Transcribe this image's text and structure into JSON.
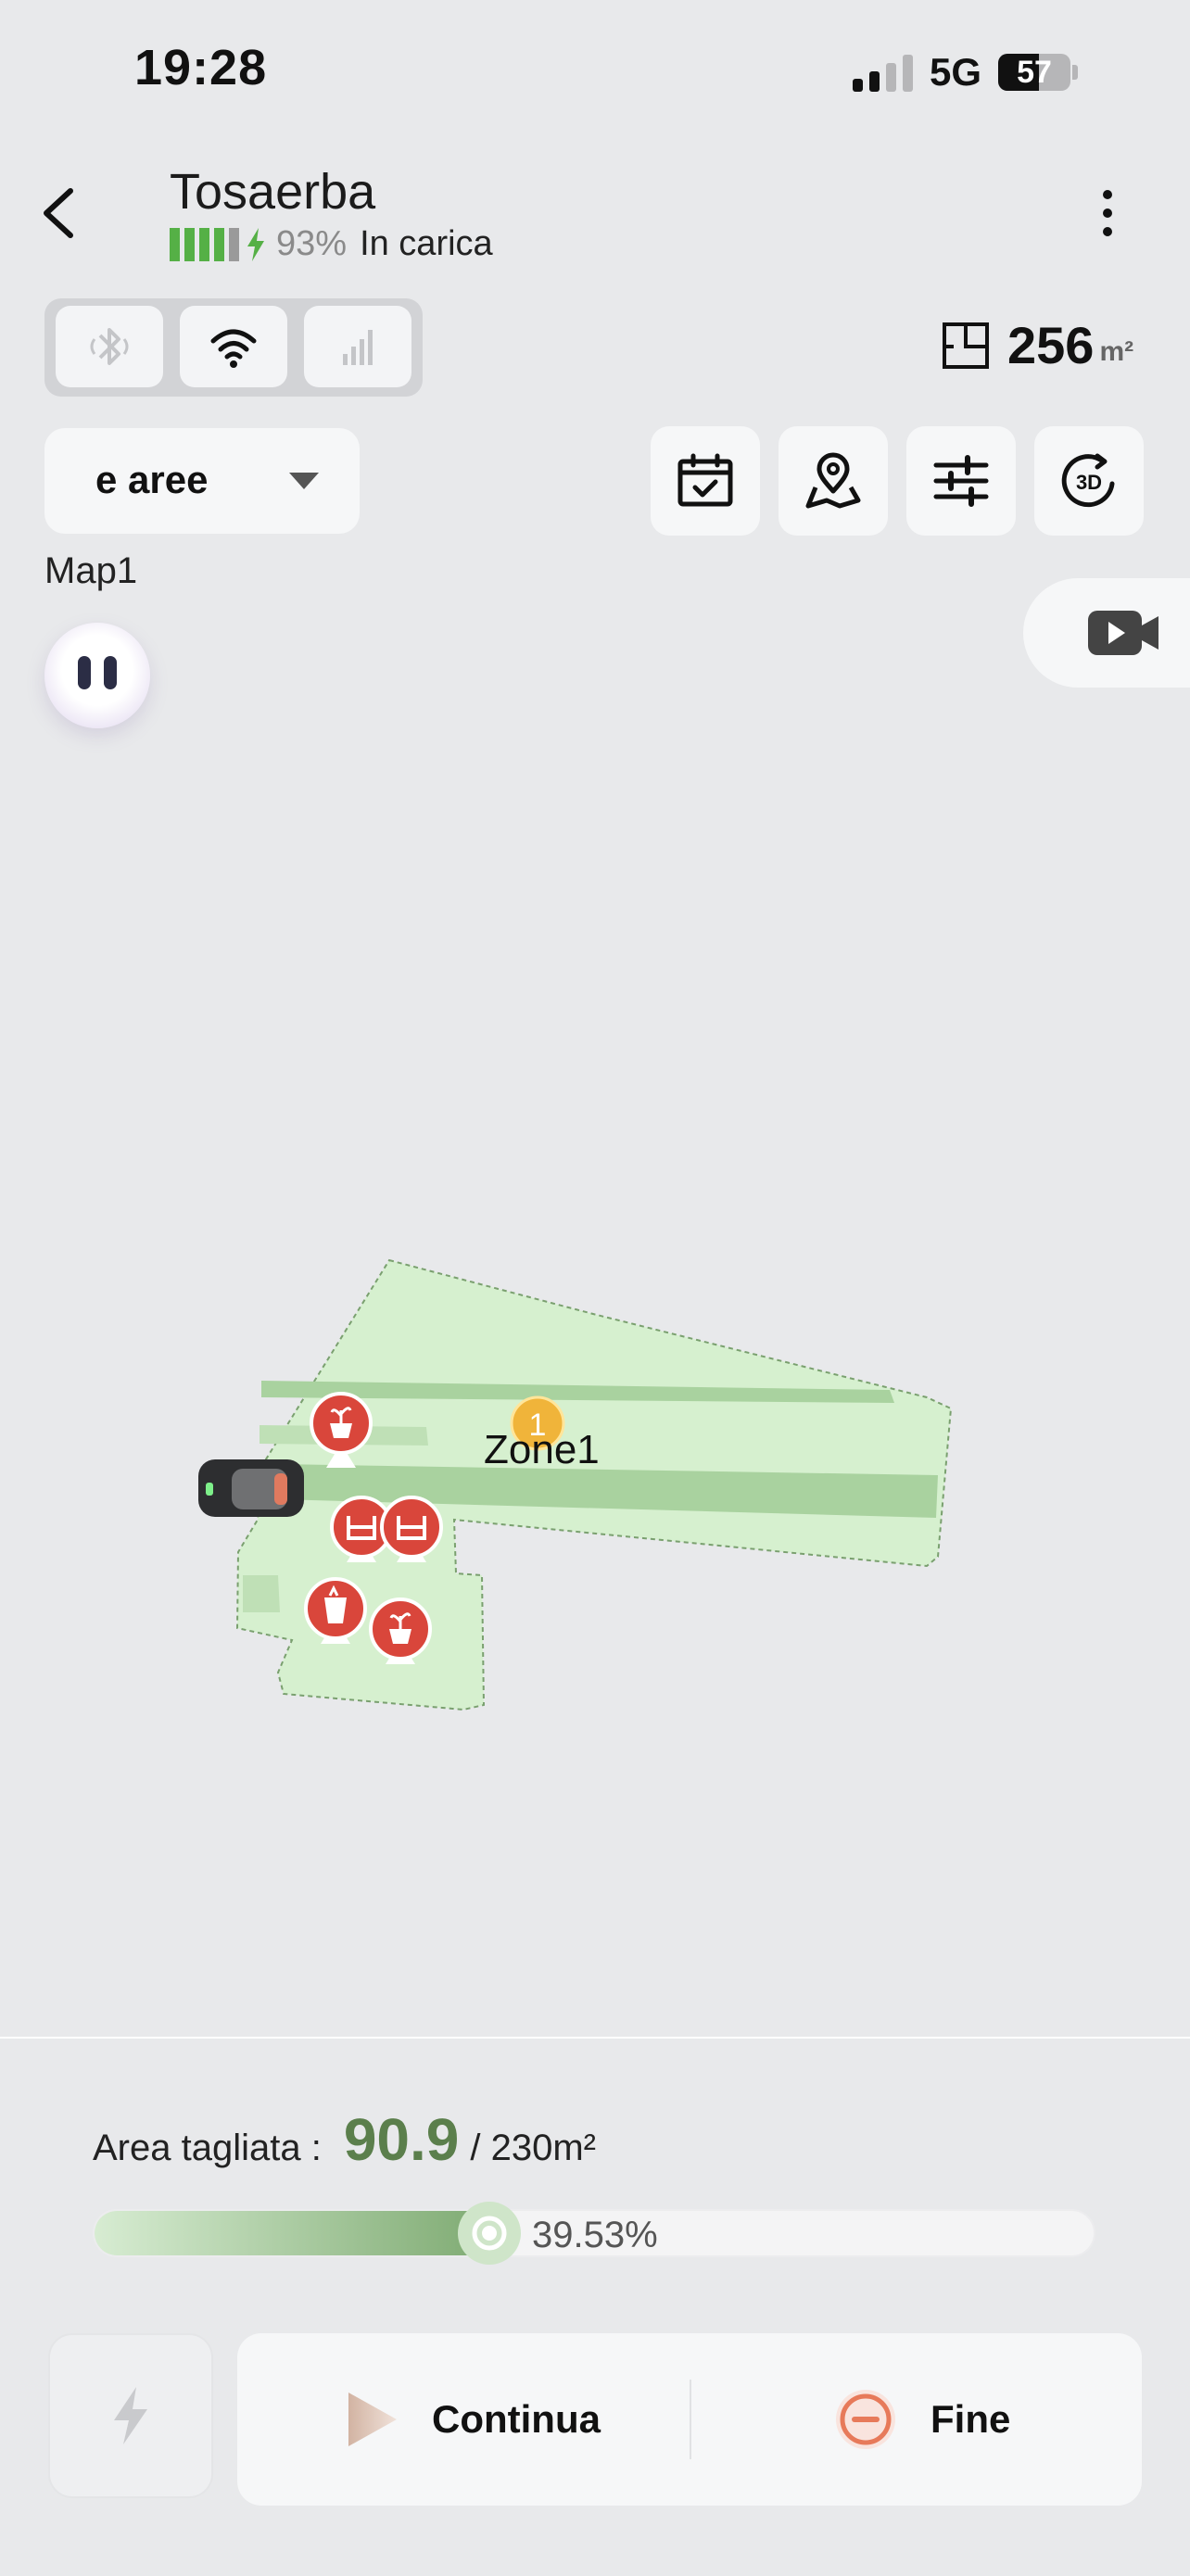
{
  "status_bar": {
    "time": "19:28",
    "network": "5G",
    "battery": "57"
  },
  "header": {
    "title": "Tosaerba",
    "battery_percent": "93%",
    "charging_label": "In carica"
  },
  "area_total": {
    "value": "256",
    "unit": "m²"
  },
  "toolbar": {
    "area_select_label": "e aree",
    "map_name": "Map1"
  },
  "map": {
    "zone_label": "Zone1",
    "zone_number": "1"
  },
  "bottom": {
    "cut_label": "Area tagliata :",
    "cut_value": "90.9",
    "cut_total": "/ 230m²",
    "progress_text": "39.53%",
    "progress_fraction": 0.3953,
    "continue_label": "Continua",
    "end_label": "Fine"
  },
  "colors": {
    "accent_green": "#5b7f4c",
    "battery_green": "#55b046",
    "obstacle_red": "#d9463b",
    "zone_marker": "#f0b43a",
    "end_orange": "#e77a5a"
  }
}
